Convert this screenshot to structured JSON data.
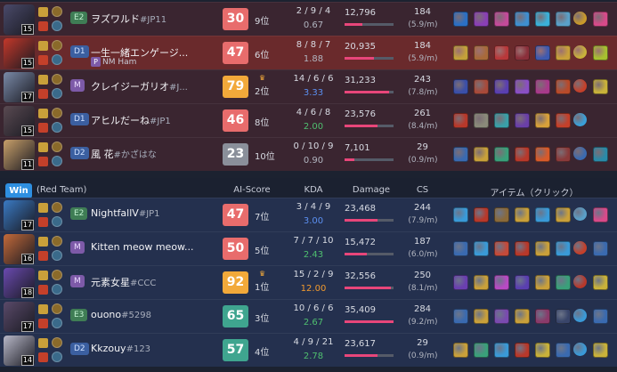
{
  "header": {
    "win_label": "Win",
    "team_label": "(Red Team)",
    "columns": {
      "score": "AI-Score",
      "kda": "KDA",
      "damage": "Damage",
      "cs": "CS",
      "items": "アイテム（クリック）"
    }
  },
  "colors": {
    "lose_row": "#3a2530",
    "highlight_row": "#6a2a2c",
    "win_row": "#24304e",
    "accent": "#e8467a"
  },
  "players": [
    {
      "team": "lose",
      "me": false,
      "level": "15",
      "rank": "E2",
      "rank_class": "e",
      "name": "ヲズワルド",
      "tag": "#JP11",
      "sub": "",
      "score": "30",
      "score_class": "red",
      "place": "9位",
      "crown": false,
      "kda": "2 / 9 / 4",
      "kda_ratio": "0.67",
      "kda_class": "",
      "damage": "12,796",
      "damage_pct": 0.37,
      "cs": "184",
      "cspm": "(5.9/m)",
      "champ_color": "#4a4a6a",
      "items": [
        "#2b6fc4",
        "#8a3fb5",
        "#c44a9a",
        "#3f8fd0",
        "#3bb0d8",
        "#5aa0c8",
        "#c99a2a",
        "#d84a8a"
      ]
    },
    {
      "team": "lose",
      "me": true,
      "level": "15",
      "rank": "D1",
      "rank_class": "d",
      "name": "一生一緒エンゲージ...",
      "tag": "",
      "sub": "NM Ham",
      "score": "47",
      "score_class": "red",
      "place": "6位",
      "crown": false,
      "kda": "8 / 8 / 7",
      "kda_ratio": "1.88",
      "kda_class": "",
      "damage": "20,935",
      "damage_pct": 0.6,
      "cs": "184",
      "cspm": "(5.9/m)",
      "champ_color": "#c4382a",
      "items": [
        "#c4a03a",
        "#a86a3a",
        "#b8383a",
        "#8a2f3a",
        "#3f5ab0",
        "#c9a03a",
        "#c9b23a",
        "#a8c030"
      ]
    },
    {
      "team": "lose",
      "me": false,
      "level": "17",
      "rank": "M",
      "rank_class": "m",
      "name": "クレイジーガリオ",
      "tag": "#J...",
      "sub": "",
      "score": "79",
      "score_class": "gold",
      "place": "2位",
      "crown": true,
      "kda": "14 / 6 / 6",
      "kda_ratio": "3.33",
      "kda_class": "blue",
      "damage": "31,233",
      "damage_pct": 0.9,
      "cs": "243",
      "cspm": "(7.8/m)",
      "champ_color": "#7a8aa8",
      "items": [
        "#3b4fa8",
        "#a84a3a",
        "#5a3fb0",
        "#8a4fc4",
        "#a83a8a",
        "#b84a2a",
        "#c4402a",
        "#c9b23a"
      ]
    },
    {
      "team": "lose",
      "me": false,
      "level": "15",
      "rank": "D1",
      "rank_class": "d",
      "name": "アヒルだーね",
      "tag": "#JP1",
      "sub": "",
      "score": "46",
      "score_class": "red",
      "place": "8位",
      "crown": false,
      "kda": "4 / 6 / 8",
      "kda_ratio": "2.00",
      "kda_class": "green",
      "damage": "23,576",
      "damage_pct": 0.68,
      "cs": "261",
      "cspm": "(8.4/m)",
      "champ_color": "#5a4a52",
      "items": [
        "#b8382a",
        "#8a8a7a",
        "#3aa0a8",
        "#6a3fa8",
        "#d8a03a",
        "#c4402a",
        "#3aa0d8"
      ]
    },
    {
      "team": "lose",
      "me": false,
      "level": "11",
      "rank": "D2",
      "rank_class": "d",
      "name": "風 花",
      "tag": "#かざはな",
      "sub": "",
      "score": "23",
      "score_class": "gray",
      "place": "10位",
      "crown": false,
      "kda": "0 / 10 / 9",
      "kda_ratio": "0.90",
      "kda_class": "",
      "damage": "7,101",
      "damage_pct": 0.2,
      "cs": "29",
      "cspm": "(0.9/m)",
      "champ_color": "#c9a06a",
      "items": [
        "#3a6ab0",
        "#c9a03a",
        "#3aa07a",
        "#b8382a",
        "#d85a2a",
        "#8a3a3a",
        "#3a6ab0",
        "#2a8aa8"
      ]
    },
    {
      "team": "win",
      "me": false,
      "level": "17",
      "rank": "E2",
      "rank_class": "e",
      "name": "NightfallV",
      "tag": "#JP1",
      "sub": "",
      "score": "47",
      "score_class": "red",
      "place": "7位",
      "crown": false,
      "kda": "3 / 4 / 9",
      "kda_ratio": "3.00",
      "kda_class": "blue",
      "damage": "23,468",
      "damage_pct": 0.67,
      "cs": "244",
      "cspm": "(7.9/m)",
      "champ_color": "#3a7ac4",
      "items": [
        "#3a9ad8",
        "#b8382a",
        "#8a6a3a",
        "#c9a03a",
        "#3a9ad8",
        "#c9a03a",
        "#5aa0c8",
        "#d84a8a"
      ]
    },
    {
      "team": "win",
      "me": false,
      "level": "16",
      "rank": "M",
      "rank_class": "m",
      "name": "Kitten meow meow...",
      "tag": "",
      "sub": "",
      "score": "50",
      "score_class": "red",
      "place": "5位",
      "crown": false,
      "kda": "7 / 7 / 10",
      "kda_ratio": "2.43",
      "kda_class": "green",
      "damage": "15,472",
      "damage_pct": 0.45,
      "cs": "187",
      "cspm": "(6.0/m)",
      "champ_color": "#c46a3a",
      "items": [
        "#3a6ab0",
        "#3a9ad8",
        "#c44a3a",
        "#b8382a",
        "#c9a03a",
        "#3a9ad8",
        "#c4402a",
        "#3a6ab0"
      ]
    },
    {
      "team": "win",
      "me": false,
      "level": "18",
      "rank": "M",
      "rank_class": "m",
      "name": "元素女星",
      "tag": "#CCC",
      "sub": "",
      "score": "92",
      "score_class": "gold",
      "place": "1位",
      "crown": true,
      "kda": "15 / 2 / 9",
      "kda_ratio": "12.00",
      "kda_class": "orange",
      "damage": "32,556",
      "damage_pct": 0.94,
      "cs": "250",
      "cspm": "(8.1/m)",
      "champ_color": "#6a4ab0",
      "items": [
        "#6a3fb0",
        "#c9a03a",
        "#b84ac4",
        "#5a3fb0",
        "#c9a03a",
        "#3aa07a",
        "#b8382a",
        "#c9b23a"
      ]
    },
    {
      "team": "win",
      "me": false,
      "level": "17",
      "rank": "E3",
      "rank_class": "e",
      "name": "ouono",
      "tag": "#5298",
      "sub": "",
      "score": "65",
      "score_class": "teal",
      "place": "3位",
      "crown": false,
      "kda": "10 / 6 / 6",
      "kda_ratio": "2.67",
      "kda_class": "green",
      "damage": "35,409",
      "damage_pct": 1.0,
      "cs": "284",
      "cspm": "(9.2/m)",
      "champ_color": "#5a4a6a",
      "items": [
        "#3a6ab0",
        "#c9a03a",
        "#7a4ab0",
        "#c9a03a",
        "#8a3a6a",
        "#39456a",
        "#3a9ad8",
        "#3a6ab0"
      ]
    },
    {
      "team": "win",
      "me": false,
      "level": "14",
      "rank": "D2",
      "rank_class": "d",
      "name": "Kkzouy",
      "tag": "#123",
      "sub": "",
      "score": "57",
      "score_class": "teal",
      "place": "4位",
      "crown": false,
      "kda": "4 / 9 / 21",
      "kda_ratio": "2.78",
      "kda_class": "green",
      "damage": "23,617",
      "damage_pct": 0.67,
      "cs": "29",
      "cspm": "(0.9/m)",
      "champ_color": "#b8b8c8",
      "items": [
        "#c9a03a",
        "#3aa07a",
        "#3a9ad8",
        "#b8382a",
        "#c9b23a",
        "#3a6ab0",
        "#3a9ad8",
        "#c9b23a"
      ]
    }
  ]
}
